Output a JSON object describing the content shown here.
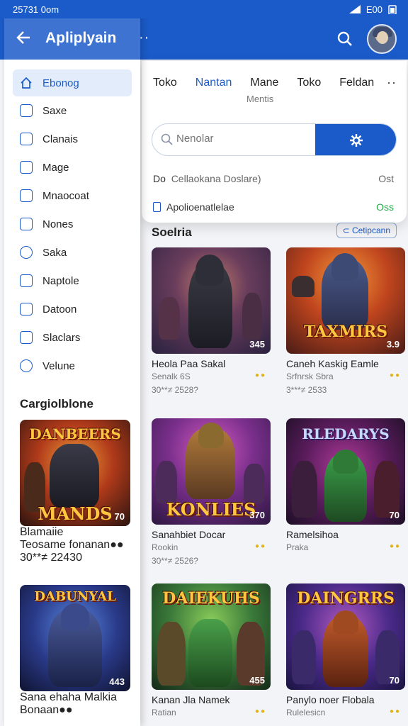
{
  "status": {
    "time": "25731 0om",
    "right": "E00"
  },
  "app": {
    "title": "Apliplyain"
  },
  "sidebar": {
    "items": [
      {
        "label": "Ebonog",
        "icon": "home-icon"
      },
      {
        "label": "Saxe",
        "icon": "plus-square-icon"
      },
      {
        "label": "Clanais",
        "icon": "square-icon"
      },
      {
        "label": "Mage",
        "icon": "download-icon"
      },
      {
        "label": "Mnaocoat",
        "icon": "box-icon"
      },
      {
        "label": "Nones",
        "icon": "list-icon"
      },
      {
        "label": "Saka",
        "icon": "circle-icon"
      },
      {
        "label": "Naptole",
        "icon": "puzzle-icon"
      },
      {
        "label": "Datoon",
        "icon": "square-icon"
      },
      {
        "label": "Slaclars",
        "icon": "bolt-icon"
      },
      {
        "label": "Velune",
        "icon": "person-icon"
      }
    ],
    "section_title": "Cargiolblone",
    "games": [
      {
        "title": "Blamaiie",
        "sub": "Teosame fonanan",
        "meta": "30**≠ 22430",
        "badge": "70",
        "logo_top": "DANBEERS",
        "logo_bottom": "MANDS"
      },
      {
        "title": "Sana ehaha Malkia",
        "sub": "Bonaan",
        "meta": "",
        "badge": "443",
        "logo_top": "DABUNYAL",
        "logo_bottom": ""
      }
    ]
  },
  "tabs": {
    "items": [
      "Toko",
      "Nantan",
      "Mane",
      "Toko",
      "Feldan"
    ],
    "active_index": 1,
    "mane_sub": "Mentis"
  },
  "search": {
    "placeholder": "Nenolar"
  },
  "rows": {
    "row1_label": "Do",
    "row1_text": "Cellaokana Doslare)",
    "row1_value": "Ost",
    "row2_text": "Apolioenatlelae",
    "row2_value": "Oss"
  },
  "section": {
    "title": "Soelria",
    "chip": "Cetipcann"
  },
  "games": [
    {
      "title": "Heola Paa Sakal",
      "sub": "Senalk 6S",
      "meta": "30**≠ 2528?",
      "badge": "345",
      "logo": ""
    },
    {
      "title": "Caneh Kaskig Eamle",
      "sub": "Srfnrsk Sbra",
      "meta": "3***≠ 2533",
      "badge": "3.9",
      "logo": "TAXMIRS"
    },
    {
      "title": "Sanahbiet Docar",
      "sub": "Rookin",
      "meta": "30**≠ 2526?",
      "badge": "370",
      "logo": "KONLIES"
    },
    {
      "title": "Ramelsihoa",
      "sub": "Praka",
      "meta": "",
      "badge": "70",
      "logo": "RLEDARYS"
    },
    {
      "title": "Kanan Jla Namek",
      "sub": "Ratian",
      "meta": "",
      "badge": "455",
      "logo": "DAIEKUHS"
    },
    {
      "title": "Panylo noer Flobala",
      "sub": "Rulelesicn",
      "meta": "",
      "badge": "70",
      "logo": "DAINGRRS"
    }
  ]
}
